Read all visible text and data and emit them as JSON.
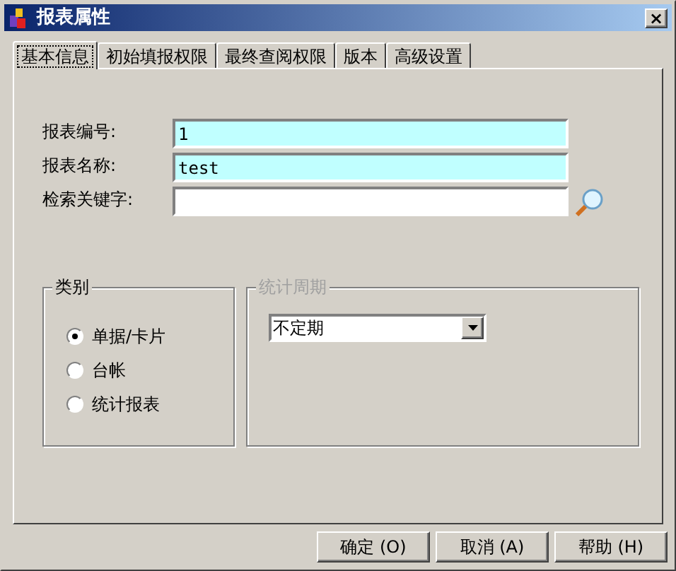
{
  "window": {
    "title": "报表属性",
    "close": "×"
  },
  "tabs": [
    {
      "label": "基本信息",
      "selected": true
    },
    {
      "label": "初始填报权限",
      "selected": false
    },
    {
      "label": "最终查阅权限",
      "selected": false
    },
    {
      "label": "版本",
      "selected": false
    },
    {
      "label": "高级设置",
      "selected": false
    }
  ],
  "fields": [
    {
      "label": "报表编号:",
      "value": "1",
      "highlighted": true,
      "search": false
    },
    {
      "label": "报表名称:",
      "value": "test",
      "highlighted": true,
      "search": false
    },
    {
      "label": "检索关键字:",
      "highlighted": false,
      "search": true
    }
  ],
  "category": {
    "title": "类别",
    "options": [
      {
        "label": "单据/卡片",
        "selected": true
      },
      {
        "label": "台帐",
        "selected": false
      },
      {
        "label": "统计报表",
        "selected": false
      }
    ]
  },
  "period": {
    "title": "统计周期",
    "disabled": true,
    "value": "不定期"
  },
  "buttons": [
    "确定 (O)",
    "取消 (A)",
    "帮助 (H)"
  ]
}
